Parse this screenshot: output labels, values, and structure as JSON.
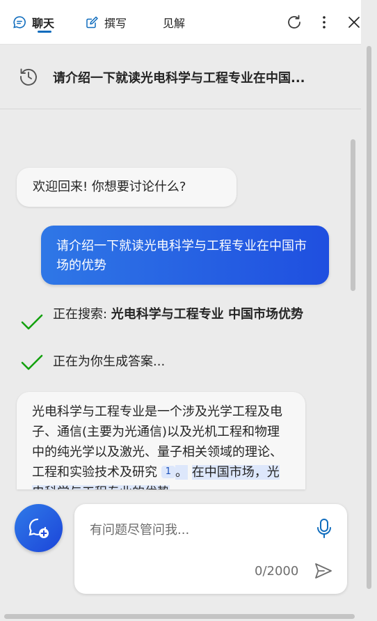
{
  "tabs": [
    {
      "label": "聊天",
      "icon": "chat-bubble-icon",
      "active": true
    },
    {
      "label": "撰写",
      "icon": "compose-icon",
      "active": false
    },
    {
      "label": "见解",
      "icon": "",
      "active": false
    }
  ],
  "header_actions": [
    "refresh-icon",
    "more-options-icon",
    "close-icon"
  ],
  "history": {
    "icon": "history-icon",
    "title": "请介绍一下就读光电科学与工程专业在中国..."
  },
  "conversation": {
    "welcome": "欢迎回来! 你想要讨论什么?",
    "user_message": "请介绍一下就读光电科学与工程专业在中国市场的优势",
    "status": {
      "searching_prefix": "正在搜索: ",
      "searching_query": "光电科学与工程专业 中国市场优势",
      "generating": "正在为你生成答案..."
    },
    "answer": {
      "text": "光电科学与工程专业是一个涉及光学工程及电子、通信(主要为光通信)以及光机工程和物理中的纯光学以及激光、量子相关领域的理论、工程和实验技术及研究",
      "citation": "1",
      "end_punct": "。",
      "next_line": "在中国市场，光电科学与工程专业的优势"
    }
  },
  "composer": {
    "placeholder": "有问题尽管问我...",
    "counter": "0/2000"
  },
  "colors": {
    "accent": "#0f6cbd",
    "user_bubble_start": "#2f77e6",
    "user_bubble_end": "#1f4fe0",
    "check": "#13a10e"
  }
}
